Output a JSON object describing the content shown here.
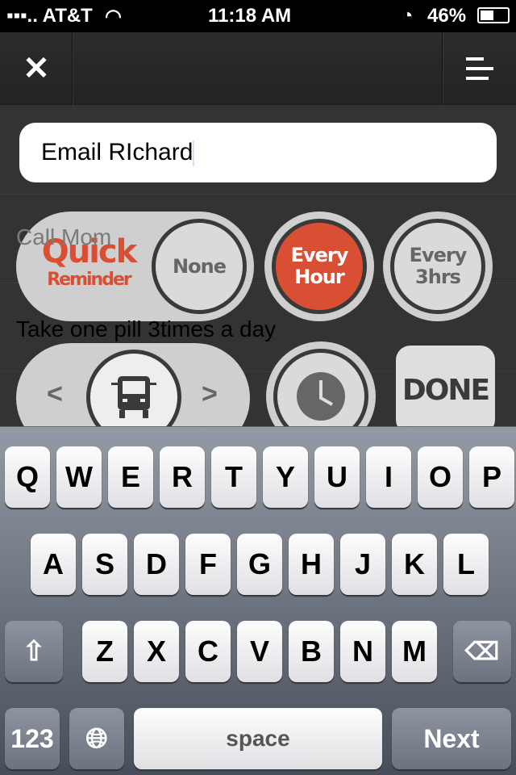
{
  "status": {
    "carrier": "AT&T",
    "time": "11:18 AM",
    "battery": "46%"
  },
  "nav": {
    "close_icon": "close-icon",
    "menu_icon": "menu-icon"
  },
  "input": {
    "value": "Email RIchard"
  },
  "list": [
    "Call Mom",
    "Take one pill 3times a day"
  ],
  "quick": {
    "line1": "Quick",
    "line2": "Reminder"
  },
  "repeat": [
    {
      "label": [
        "None"
      ],
      "selected": false
    },
    {
      "label": [
        "Every",
        "Hour"
      ],
      "selected": true
    },
    {
      "label": [
        "Every",
        "3hrs"
      ],
      "selected": false
    }
  ],
  "done": "DONE",
  "keyboard": {
    "row1": [
      "Q",
      "W",
      "E",
      "R",
      "T",
      "Y",
      "U",
      "I",
      "O",
      "P"
    ],
    "row2": [
      "A",
      "S",
      "D",
      "F",
      "G",
      "H",
      "J",
      "K",
      "L"
    ],
    "row3": [
      "Z",
      "X",
      "C",
      "V",
      "B",
      "N",
      "M"
    ],
    "numbers": "123",
    "space": "space",
    "next": "Next"
  },
  "colors": {
    "accent": "#d94f34"
  }
}
